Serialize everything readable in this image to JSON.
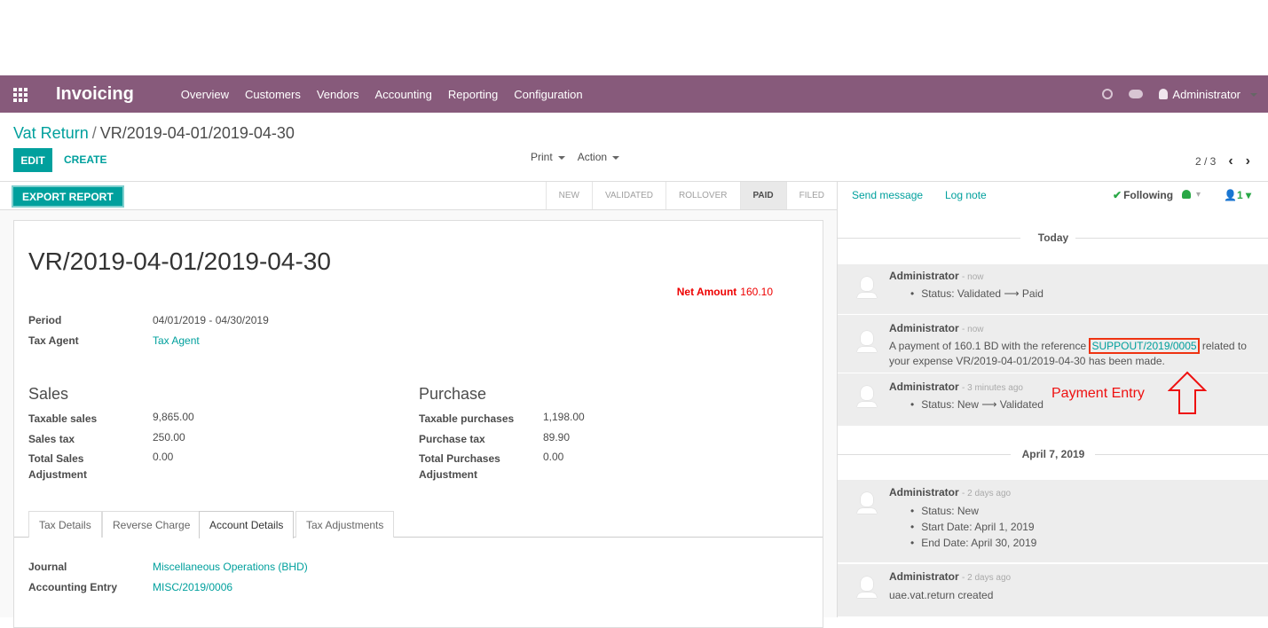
{
  "navbar": {
    "app_name": "Invoicing",
    "menu": [
      "Overview",
      "Customers",
      "Vendors",
      "Accounting",
      "Reporting",
      "Configuration"
    ],
    "user": "Administrator"
  },
  "breadcrumb": {
    "parent": "Vat Return",
    "current": "VR/2019-04-01/2019-04-30"
  },
  "buttons": {
    "edit": "EDIT",
    "create": "CREATE",
    "export": "EXPORT REPORT"
  },
  "cp": {
    "print": "Print",
    "action": "Action",
    "pager": "2 / 3"
  },
  "stages": [
    "NEW",
    "VALIDATED",
    "ROLLOVER",
    "PAID",
    "FILED"
  ],
  "active_stage": "PAID",
  "record": {
    "title": "VR/2019-04-01/2019-04-30",
    "net_amount_label": "Net Amount",
    "net_amount": "160.10",
    "period_label": "Period",
    "period": "04/01/2019 - 04/30/2019",
    "tax_agent_label": "Tax Agent",
    "tax_agent": "Tax Agent"
  },
  "sales": {
    "title": "Sales",
    "rows": [
      {
        "label": "Taxable sales",
        "value": "9,865.00"
      },
      {
        "label": "Sales tax",
        "value": "250.00"
      },
      {
        "label": "Total Sales Adjustment",
        "value": "0.00"
      }
    ]
  },
  "purchase": {
    "title": "Purchase",
    "rows": [
      {
        "label": "Taxable purchases",
        "value": "1,198.00"
      },
      {
        "label": "Purchase tax",
        "value": "89.90"
      },
      {
        "label": "Total Purchases Adjustment",
        "value": "0.00"
      }
    ]
  },
  "tabs": [
    "Tax Details",
    "Reverse Charge",
    "Account Details",
    "Tax Adjustments"
  ],
  "active_tab": "Account Details",
  "account": {
    "journal_label": "Journal",
    "journal": "Miscellaneous Operations (BHD)",
    "entry_label": "Accounting Entry",
    "entry": "MISC/2019/0006"
  },
  "chatter": {
    "send_message": "Send message",
    "log_note": "Log note",
    "following": "Following",
    "followers": "1",
    "date_today": "Today",
    "date_april": "April 7, 2019",
    "messages": [
      {
        "author": "Administrator",
        "time": "- now",
        "lines": [
          "Status: Validated ⟶ Paid"
        ]
      },
      {
        "author": "Administrator",
        "time": "- now",
        "text_before": "A payment of 160.1 BD with the reference ",
        "reference": "SUPPOUT/2019/0005",
        "text_after": " related to",
        "text_line2": "your expense VR/2019-04-01/2019-04-30 has been made."
      },
      {
        "author": "Administrator",
        "time": "- 3 minutes ago",
        "lines": [
          "Status: New ⟶ Validated"
        ]
      },
      {
        "author": "Administrator",
        "time": "- 2 days ago",
        "lines": [
          "Status: New",
          "Start Date: April 1, 2019",
          "End Date: April 30, 2019"
        ]
      },
      {
        "author": "Administrator",
        "time": "- 2 days ago",
        "lines": [
          "uae.vat.return created"
        ]
      }
    ]
  },
  "annotation": {
    "text": "Payment Entry",
    "color": "#e11"
  },
  "colors": {
    "navbar": "#875A7B",
    "primary": "#00A09D",
    "danger": "#e00"
  }
}
